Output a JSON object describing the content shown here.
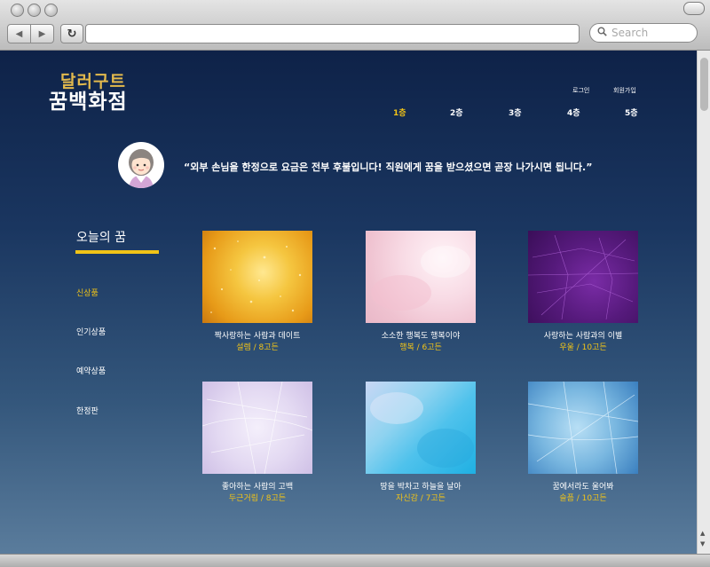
{
  "browser": {
    "search_placeholder": "Search"
  },
  "site": {
    "logo_line1": "달러구트",
    "logo_line2": "꿈백화점",
    "util_links": [
      "로그인",
      "회원가입"
    ],
    "floors": [
      "1층",
      "2층",
      "3층",
      "4층",
      "5층"
    ],
    "active_floor": 0,
    "notice": "“외부 손님을 한정으로 요금은 전부 후불입니다! 직원에게 꿈을 받으셨으면 곧장 나가시면 됩니다.”"
  },
  "sidebar": {
    "title": "오늘의 꿈",
    "items": [
      "신상품",
      "인기상품",
      "예약상품",
      "한정판"
    ],
    "active_item": 0
  },
  "products": [
    {
      "title": "짝사랑하는 사람과 데이트",
      "meta": "설렘 / 8고든",
      "texture": "gold-glitter",
      "colors": [
        "#f0b42a",
        "#ffd86a"
      ]
    },
    {
      "title": "소소한 행복도 행복이야",
      "meta": "행복 / 6고든",
      "texture": "pink-watercolor",
      "colors": [
        "#f3c8d3",
        "#fde7ee"
      ]
    },
    {
      "title": "사랑하는 사람과의 이별",
      "meta": "우울 / 10고든",
      "texture": "purple-scratch",
      "colors": [
        "#4e1770",
        "#8a3cb0"
      ]
    },
    {
      "title": "좋아하는 사람의 고백",
      "meta": "두근거림 / 8고든",
      "texture": "lavender-scratch",
      "colors": [
        "#d8cdee",
        "#f1ecfa"
      ]
    },
    {
      "title": "땅을 박차고 하늘을 날아",
      "meta": "자신감 / 7고든",
      "texture": "cyan-watercolor",
      "colors": [
        "#56c3ea",
        "#b9d2f2"
      ]
    },
    {
      "title": "꿈에서라도 울어봐",
      "meta": "슬픔 / 10고든",
      "texture": "ice-blue",
      "colors": [
        "#3a7fbf",
        "#a4d2ee"
      ]
    }
  ]
}
